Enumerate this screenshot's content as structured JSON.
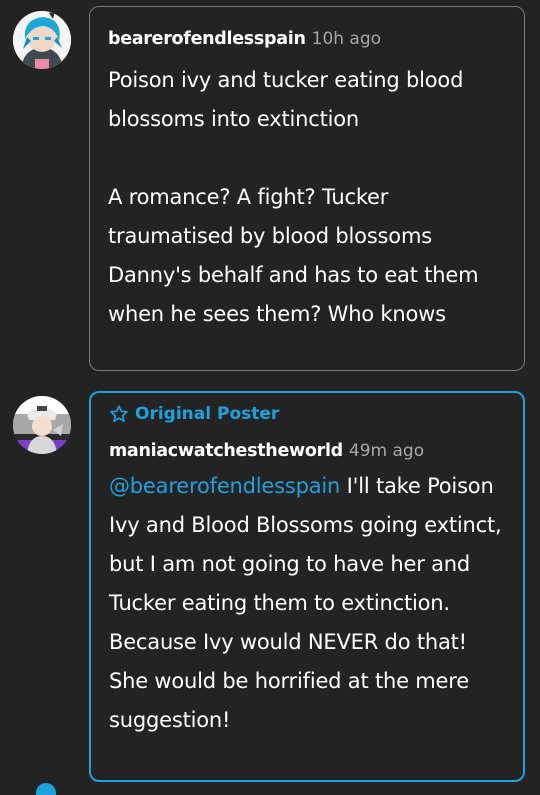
{
  "reply1": {
    "username": "bearerofendlesspain",
    "time": "10h ago",
    "paragraphs": [
      "Poison ivy and tucker eating blood blossoms into extinction",
      "A romance? A fight? Tucker traumatised by blood blossoms Danny's behalf and has to eat them when he sees them? Who knows"
    ]
  },
  "reply2": {
    "badge": "Original Poster",
    "username": "maniacwatchestheworld",
    "time": "49m ago",
    "mention": "@bearerofendlesspain",
    "text": " I'll take Poison Ivy and Blood Blossoms going extinct, but I am not going to have her and Tucker eating them to extinction. Because Ivy would NEVER do that! She would be horrified at the mere suggestion!"
  },
  "colors": {
    "background": "#232323",
    "accent": "#1ea2dd",
    "border": "#7a7a7a",
    "meta": "#a7a7a7"
  },
  "icons": [
    "avatar-bearerofendlesspain",
    "avatar-maniacwatchestheworld",
    "star-outline-icon"
  ]
}
